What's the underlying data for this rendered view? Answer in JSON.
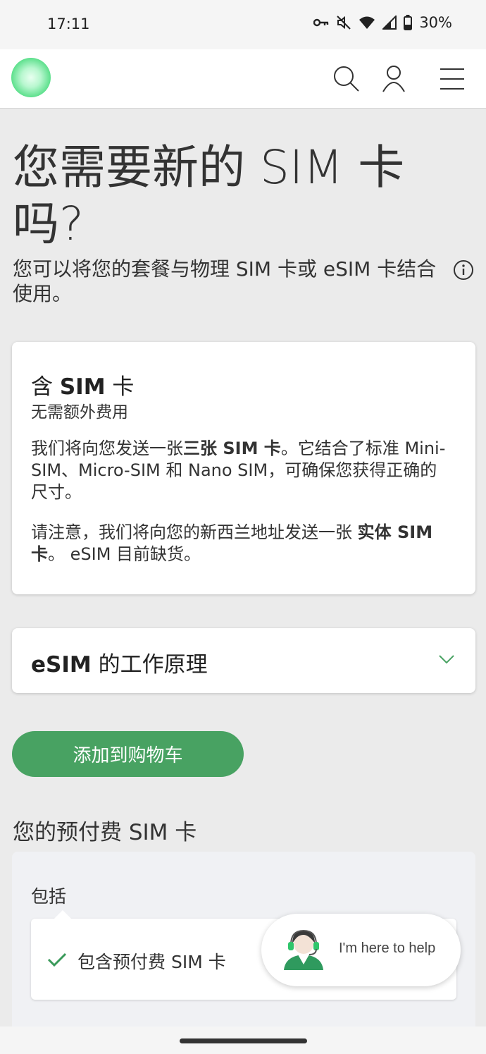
{
  "status_bar": {
    "time": "17:11",
    "battery": "30%",
    "icons": [
      "key-icon",
      "mute-icon",
      "wifi-icon",
      "signal-icon",
      "battery-icon"
    ]
  },
  "nav": {
    "icons": [
      "logo-icon",
      "search-icon",
      "account-icon",
      "menu-icon"
    ]
  },
  "hero": {
    "title": "您需要新的 SIM 卡吗?",
    "subtitle": "您可以将您的套餐与物理 SIM 卡或 eSIM 卡结合使用。"
  },
  "sim_card": {
    "title_prefix": "含 ",
    "title_bold": "SIM",
    "title_suffix": " 卡",
    "sub": "无需额外费用",
    "para1_a": "我们将向您发送一张",
    "para1_bold": "三张 SIM 卡",
    "para1_b": "。它结合了标准 Mini-SIM、Micro-SIM 和 Nano SIM，可确保您获得正确的尺寸。",
    "para2_a": "请注意，我们将向您的新西兰地址发送一张 ",
    "para2_bold": "实体 SIM 卡",
    "para2_b": "。 eSIM 目前缺货。"
  },
  "esim_accordion": {
    "title_bold": "eSIM",
    "title_rest": " 的工作原理"
  },
  "cart": {
    "add_label": "添加到购物车"
  },
  "prepaid": {
    "heading": "您的预付费 SIM 卡",
    "includes_label": "包括",
    "item": "包含预付费 SIM 卡"
  },
  "help": {
    "text": "I'm here to help"
  },
  "colors": {
    "accent": "#48a262",
    "page_bg": "#ebebeb",
    "check": "#3a9a5a"
  }
}
